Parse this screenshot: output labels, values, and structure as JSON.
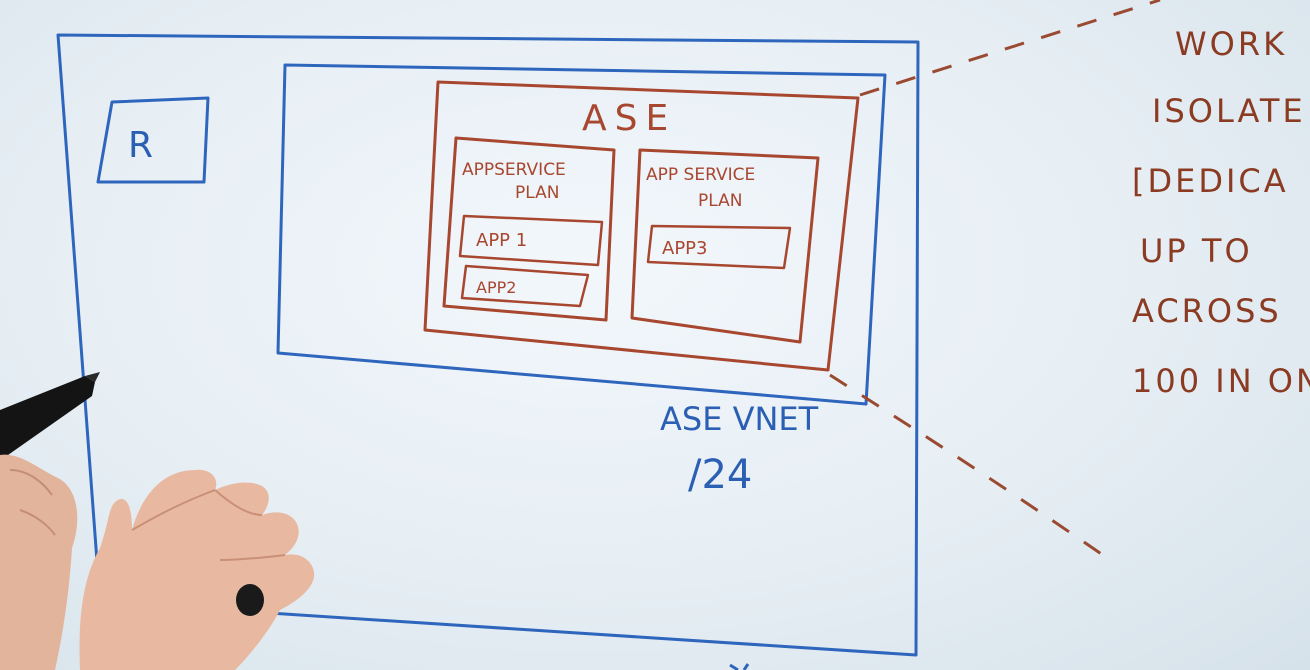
{
  "whiteboard": {
    "router_label": "R",
    "ase_title": "ASE",
    "plan1": {
      "line1": "APPSERVICE",
      "line2": "PLAN",
      "app_a": "APP 1",
      "app_b": "APP2"
    },
    "plan2": {
      "line1": "APP SERVICE",
      "line2": "PLAN",
      "app_a": "APP3"
    },
    "vnet_label": "ASE VNET",
    "vnet_cidr": "/24",
    "notes": [
      "WORK",
      "ISOLATE",
      "[DEDICA",
      "UP TO",
      "ACROSS",
      "100 IN ON"
    ],
    "colors": {
      "blue_marker": "#2b5fb3",
      "red_marker": "#a8472f",
      "board": "#eef4f8"
    }
  }
}
